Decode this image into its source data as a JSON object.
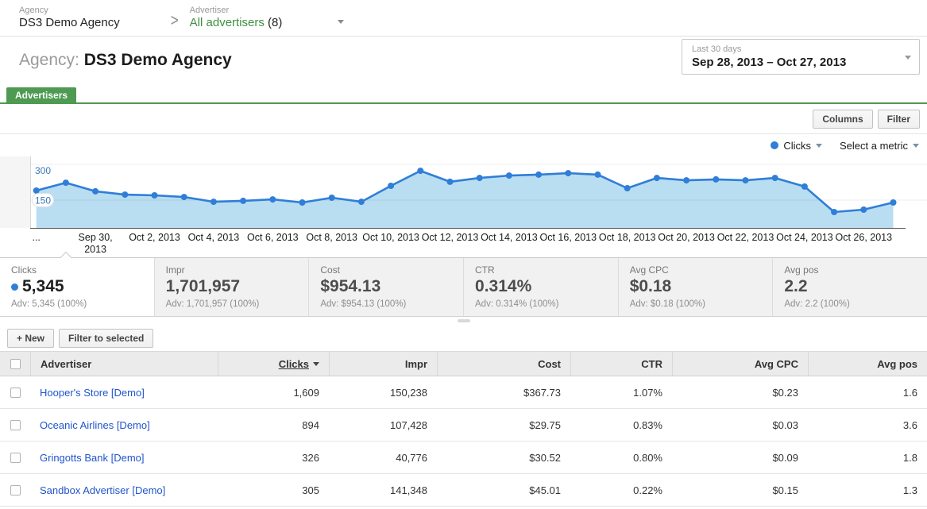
{
  "breadcrumb": {
    "agency_label": "Agency",
    "agency_name": "DS3 Demo Agency",
    "advertiser_label": "Advertiser",
    "advertiser_value": "All advertisers",
    "advertiser_count": "(8)"
  },
  "header": {
    "title_prefix": "Agency:",
    "title_name": "DS3 Demo Agency",
    "date_preset": "Last 30 days",
    "date_range": "Sep 28, 2013 – Oct 27, 2013"
  },
  "tabs": {
    "advertisers": "Advertisers"
  },
  "toolbar": {
    "columns_label": "Columns",
    "filter_label": "Filter"
  },
  "chart_controls": {
    "metric1": "Clicks",
    "metric2": "Select a metric"
  },
  "chart_data": {
    "type": "area",
    "series_name": "Clicks",
    "x": [
      "Sep 28",
      "Sep 29",
      "Sep 30",
      "Oct 1",
      "Oct 2",
      "Oct 3",
      "Oct 4",
      "Oct 5",
      "Oct 6",
      "Oct 7",
      "Oct 8",
      "Oct 9",
      "Oct 10",
      "Oct 11",
      "Oct 12",
      "Oct 13",
      "Oct 14",
      "Oct 15",
      "Oct 16",
      "Oct 17",
      "Oct 18",
      "Oct 19",
      "Oct 20",
      "Oct 21",
      "Oct 22",
      "Oct 23",
      "Oct 24",
      "Oct 25",
      "Oct 26",
      "Oct 27"
    ],
    "values": [
      190,
      223,
      187,
      173,
      170,
      163,
      143,
      147,
      153,
      140,
      160,
      143,
      210,
      273,
      227,
      243,
      253,
      257,
      263,
      257,
      200,
      243,
      233,
      237,
      233,
      243,
      207,
      100,
      110,
      140
    ],
    "y_ticks": [
      {
        "v": 300,
        "label": "300"
      },
      {
        "v": 150,
        "label": "150",
        "boxed": true
      }
    ],
    "x_ticks": [
      {
        "i": 0,
        "t": "..."
      },
      {
        "i": 2,
        "t": "Sep 30,",
        "t2": "2013"
      },
      {
        "i": 4,
        "t": "Oct 2, 2013"
      },
      {
        "i": 6,
        "t": "Oct 4, 2013"
      },
      {
        "i": 8,
        "t": "Oct 6, 2013"
      },
      {
        "i": 10,
        "t": "Oct 8, 2013"
      },
      {
        "i": 12,
        "t": "Oct 10, 2013"
      },
      {
        "i": 14,
        "t": "Oct 12, 2013"
      },
      {
        "i": 16,
        "t": "Oct 14, 2013"
      },
      {
        "i": 18,
        "t": "Oct 16, 2013"
      },
      {
        "i": 20,
        "t": "Oct 18, 2013"
      },
      {
        "i": 22,
        "t": "Oct 20, 2013"
      },
      {
        "i": 24,
        "t": "Oct 22, 2013"
      },
      {
        "i": 26,
        "t": "Oct 24, 2013"
      },
      {
        "i": 28,
        "t": "Oct 26, 2013"
      }
    ],
    "ylim": [
      30,
      315
    ],
    "grid": true,
    "line_color": "#2f7ed8",
    "fill_color": "#b9ddf1",
    "axis_label_color": "#3a79b8"
  },
  "summary_cards": [
    {
      "label": "Clicks",
      "value": "5,345",
      "sub": "Adv: 5,345 (100%)"
    },
    {
      "label": "Impr",
      "value": "1,701,957",
      "sub": "Adv: 1,701,957 (100%)"
    },
    {
      "label": "Cost",
      "value": "$954.13",
      "sub": "Adv: $954.13 (100%)"
    },
    {
      "label": "CTR",
      "value": "0.314%",
      "sub": "Adv: 0.314% (100%)"
    },
    {
      "label": "Avg CPC",
      "value": "$0.18",
      "sub": "Adv: $0.18 (100%)"
    },
    {
      "label": "Avg pos",
      "value": "2.2",
      "sub": "Adv: 2.2 (100%)"
    }
  ],
  "actions": {
    "new_label": "+ New",
    "filter_selected_label": "Filter to selected"
  },
  "table": {
    "columns": {
      "advertiser": "Advertiser",
      "clicks": "Clicks",
      "impr": "Impr",
      "cost": "Cost",
      "ctr": "CTR",
      "avg_cpc": "Avg CPC",
      "avg_pos": "Avg pos"
    },
    "sorted_by": "Clicks",
    "rows": [
      {
        "advertiser": "Hooper's Store [Demo]",
        "clicks": "1,609",
        "impr": "150,238",
        "cost": "$367.73",
        "ctr": "1.07%",
        "avg_cpc": "$0.23",
        "avg_pos": "1.6"
      },
      {
        "advertiser": "Oceanic Airlines [Demo]",
        "clicks": "894",
        "impr": "107,428",
        "cost": "$29.75",
        "ctr": "0.83%",
        "avg_cpc": "$0.03",
        "avg_pos": "3.6"
      },
      {
        "advertiser": "Gringotts Bank [Demo]",
        "clicks": "326",
        "impr": "40,776",
        "cost": "$30.52",
        "ctr": "0.80%",
        "avg_cpc": "$0.09",
        "avg_pos": "1.8"
      },
      {
        "advertiser": "Sandbox Advertiser [Demo]",
        "clicks": "305",
        "impr": "141,348",
        "cost": "$45.01",
        "ctr": "0.22%",
        "avg_cpc": "$0.15",
        "avg_pos": "1.3"
      }
    ]
  },
  "colors": {
    "brand_green": "#4e9a52",
    "link_blue": "#2155cc",
    "series_blue": "#2f7ed8"
  }
}
